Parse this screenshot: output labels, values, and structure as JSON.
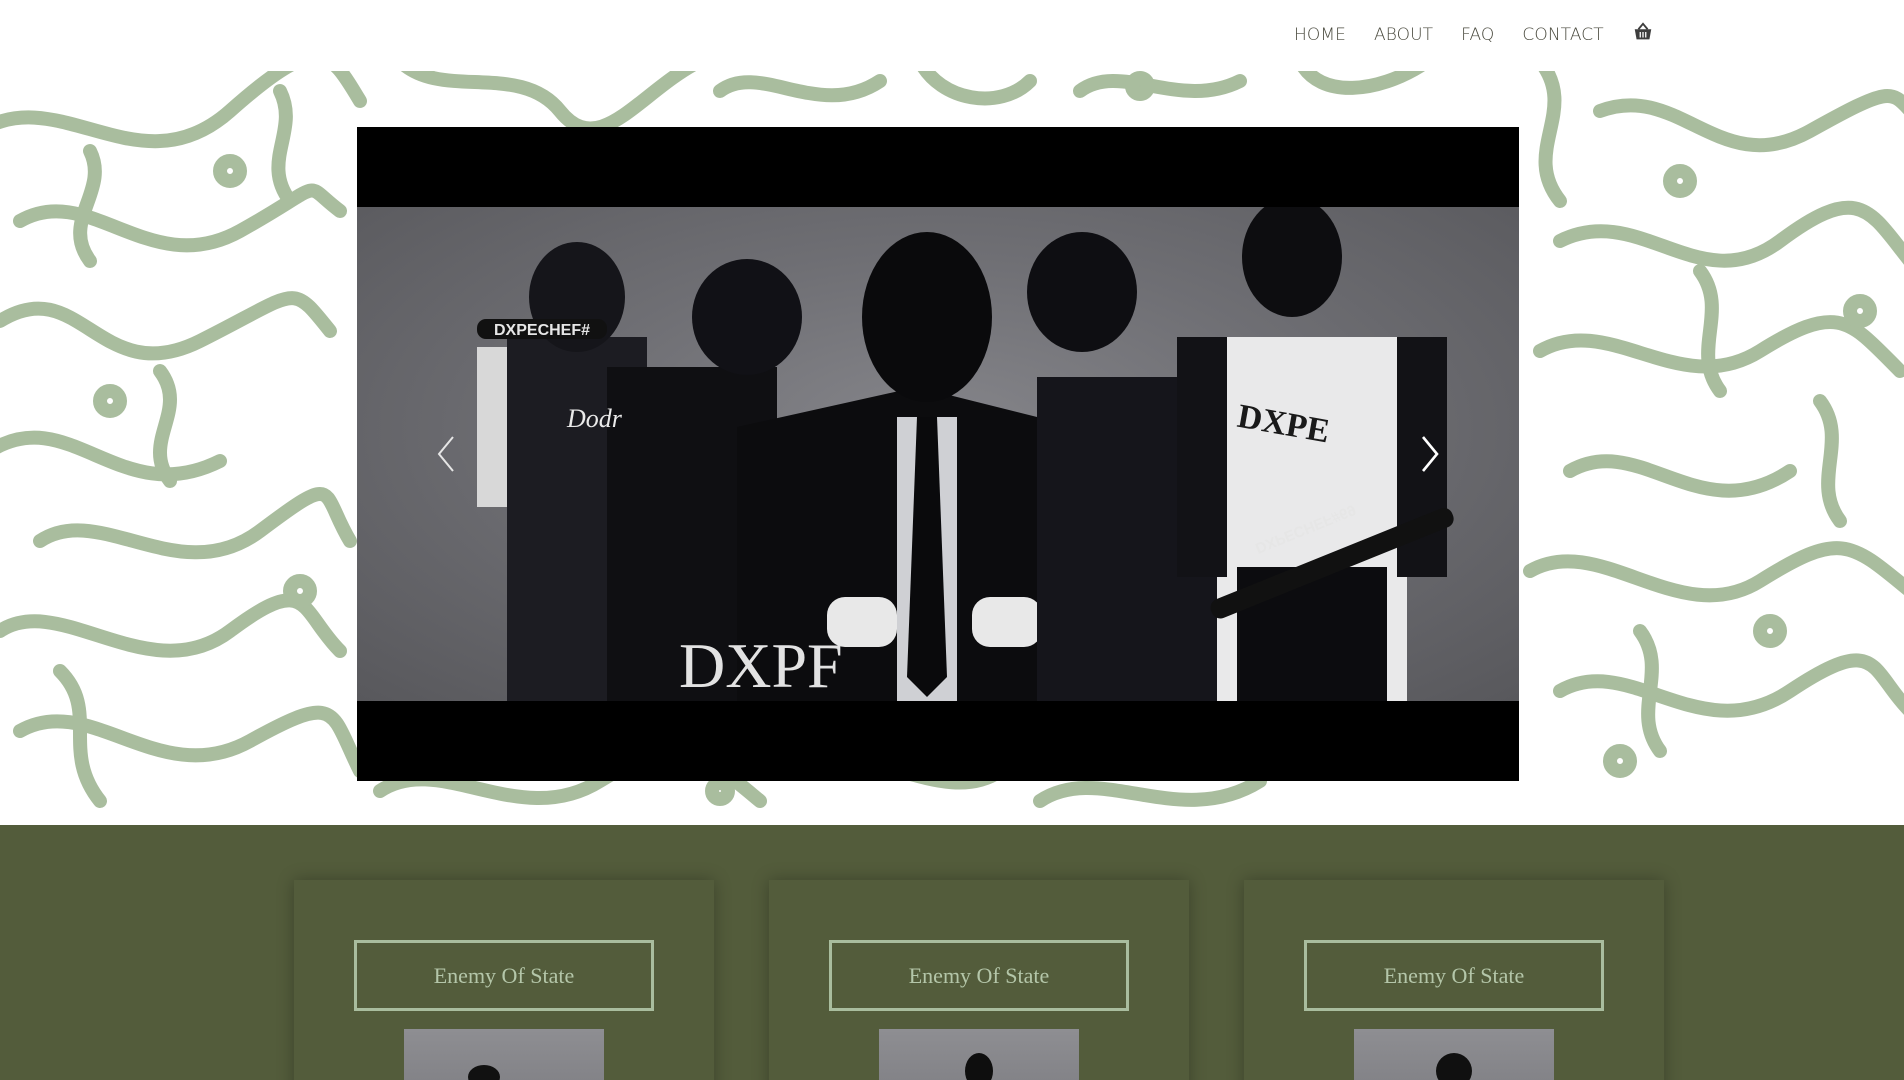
{
  "nav": {
    "items": [
      {
        "label": "HOME"
      },
      {
        "label": "ABOUT"
      },
      {
        "label": "FAQ"
      },
      {
        "label": "CONTACT"
      }
    ],
    "cart_icon": "basket-icon"
  },
  "hero": {
    "pattern_color": "#a9bd9e",
    "slide_texts": {
      "bat_left": "DXPECHEF#",
      "jersey_left": "Dodr",
      "shorts": "DXPF",
      "shirt_right": "DXPE",
      "bat_right": "DXPECHEF#69"
    },
    "prev_icon": "chevron-left-icon",
    "next_icon": "chevron-right-icon"
  },
  "cards": [
    {
      "title": "Enemy Of State"
    },
    {
      "title": "Enemy Of State"
    },
    {
      "title": "Enemy Of State"
    }
  ],
  "colors": {
    "band_bg": "#535c3b",
    "card_border": "#a9bd9e",
    "card_text": "#b4c6a9"
  }
}
